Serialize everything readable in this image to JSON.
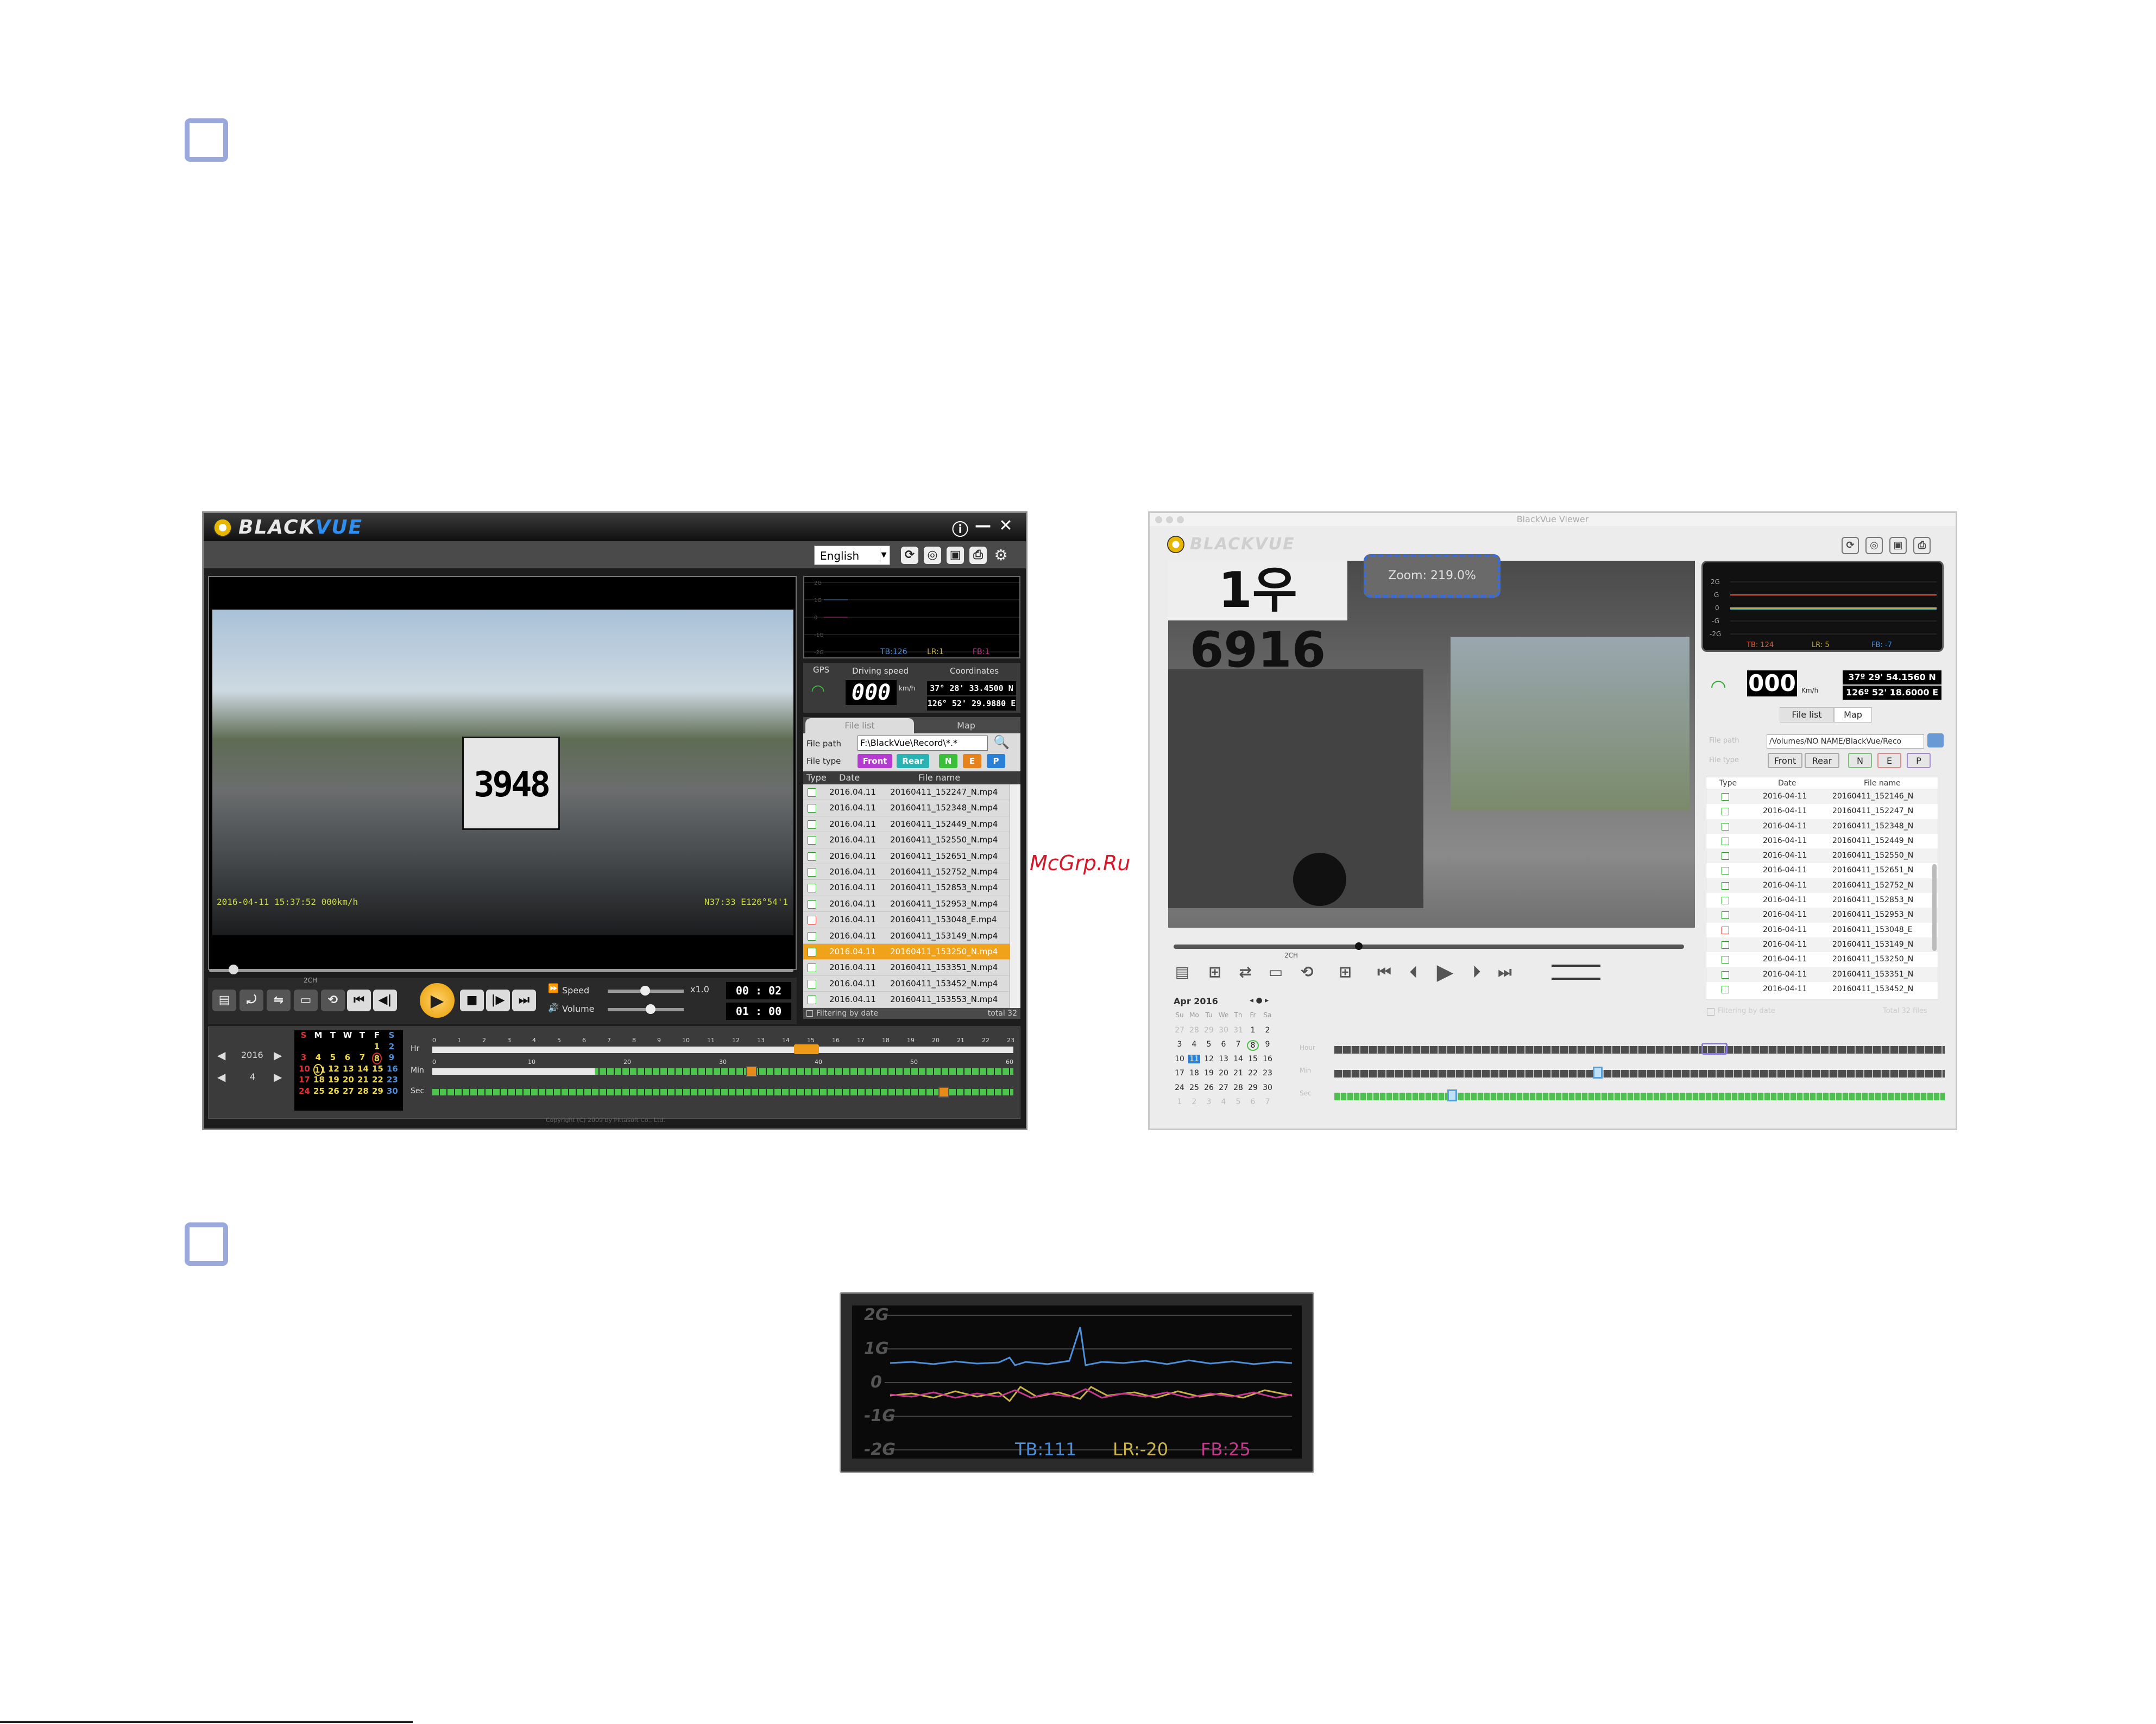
{
  "watermark": "McGrp.Ru",
  "windows_viewer": {
    "brand_prefix": "BLACK",
    "brand_suffix": "VUE",
    "title_buttons": [
      "ⓘ",
      "—",
      "✕"
    ],
    "language": "English",
    "toolbar_icons": [
      "refresh-icon",
      "map-upload-icon",
      "camera-icon",
      "print-icon",
      "gear-icon"
    ],
    "video": {
      "plate_text": "3948",
      "timestamp_left": "2016-04-11  15:37:52  000km/h",
      "timestamp_right": "N37:33  E126°54'1"
    },
    "playback": {
      "speed_label": "Speed",
      "speed_value": "x1.0",
      "volume_label": "Volume",
      "current_time": "00 : 02",
      "total_time": "01 : 00",
      "channel_label": "2CH"
    },
    "gsensor": {
      "y_labels": [
        "2G",
        "1G",
        "0",
        "-1G",
        "-2G"
      ],
      "legend": {
        "tb": "TB:126",
        "lr": "LR:1",
        "fb": "FB:1"
      }
    },
    "gps": {
      "gps_label": "GPS",
      "speed_label": "Driving speed",
      "speed_value": "000",
      "speed_unit": "km/h",
      "coords_label": "Coordinates",
      "lat": "37° 28' 33.4500 N",
      "lon": "126° 52' 29.9880 E"
    },
    "file_panel": {
      "tabs": [
        "File list",
        "Map"
      ],
      "file_path_label": "File path",
      "file_path_value": "F:\\BlackVue\\Record\\*.*",
      "file_type_label": "File type",
      "type_buttons": [
        "Front",
        "Rear",
        "N",
        "E",
        "P"
      ],
      "columns": [
        "Type",
        "Date",
        "File name"
      ],
      "rows": [
        {
          "date": "2016.04.11",
          "file": "20160411_152247_N.mp4",
          "event": false,
          "selected": false
        },
        {
          "date": "2016.04.11",
          "file": "20160411_152348_N.mp4",
          "event": false,
          "selected": false
        },
        {
          "date": "2016.04.11",
          "file": "20160411_152449_N.mp4",
          "event": false,
          "selected": false
        },
        {
          "date": "2016.04.11",
          "file": "20160411_152550_N.mp4",
          "event": false,
          "selected": false
        },
        {
          "date": "2016.04.11",
          "file": "20160411_152651_N.mp4",
          "event": false,
          "selected": false
        },
        {
          "date": "2016.04.11",
          "file": "20160411_152752_N.mp4",
          "event": false,
          "selected": false
        },
        {
          "date": "2016.04.11",
          "file": "20160411_152853_N.mp4",
          "event": false,
          "selected": false
        },
        {
          "date": "2016.04.11",
          "file": "20160411_152953_N.mp4",
          "event": false,
          "selected": false
        },
        {
          "date": "2016.04.11",
          "file": "20160411_153048_E.mp4",
          "event": true,
          "selected": false
        },
        {
          "date": "2016.04.11",
          "file": "20160411_153149_N.mp4",
          "event": false,
          "selected": false
        },
        {
          "date": "2016.04.11",
          "file": "20160411_153250_N.mp4",
          "event": false,
          "selected": true
        },
        {
          "date": "2016.04.11",
          "file": "20160411_153351_N.mp4",
          "event": false,
          "selected": false
        },
        {
          "date": "2016.04.11",
          "file": "20160411_153452_N.mp4",
          "event": false,
          "selected": false
        },
        {
          "date": "2016.04.11",
          "file": "20160411_153553_N.mp4",
          "event": false,
          "selected": false
        }
      ],
      "filter_label": "Filtering by date",
      "total": "total 32"
    },
    "timeline": {
      "year": "2016",
      "month": "4",
      "row_labels": [
        "Hr",
        "Min",
        "Sec"
      ],
      "weekdays": [
        "S",
        "M",
        "T",
        "W",
        "T",
        "F",
        "S"
      ],
      "weeks": [
        [
          "",
          "",
          "",
          "",
          "",
          "1",
          "2"
        ],
        [
          "3",
          "4",
          "5",
          "6",
          "7",
          "8",
          "9"
        ],
        [
          "10",
          "11",
          "12",
          "13",
          "14",
          "15",
          "16"
        ],
        [
          "17",
          "18",
          "19",
          "20",
          "21",
          "22",
          "23"
        ],
        [
          "24",
          "25",
          "26",
          "27",
          "28",
          "29",
          "30"
        ]
      ],
      "hour_ticks": [
        "0",
        "1",
        "2",
        "3",
        "4",
        "5",
        "6",
        "7",
        "8",
        "9",
        "10",
        "11",
        "12",
        "13",
        "14",
        "15",
        "16",
        "17",
        "18",
        "19",
        "20",
        "21",
        "22",
        "23"
      ],
      "minute_ticks": [
        "0",
        "10",
        "20",
        "30",
        "40",
        "50",
        "60"
      ]
    },
    "copyright": "Copyright (C) 2009 by Pittasoft Co., Ltd."
  },
  "mac_viewer": {
    "window_title": "BlackVue Viewer",
    "brand": "BLACKVUE",
    "toolbar_icons": [
      "refresh-icon",
      "map-upload-icon",
      "camera-icon",
      "print-icon"
    ],
    "video": {
      "plate_text": "1우6916",
      "zoom_label": "Zoom: 219.0%"
    },
    "controls": [
      "snapshot-icon",
      "record-icon",
      "channel-switch-icon",
      "pip-icon",
      "fullscreen-icon",
      "grid-icon",
      "skip-back-icon",
      "step-back-icon",
      "play-icon",
      "step-forward-icon",
      "skip-forward-icon"
    ],
    "channel_label": "2CH",
    "gsensor": {
      "y_labels": [
        "2G",
        "G",
        "0",
        "-G",
        "-2G"
      ],
      "legend": {
        "tb": "TB: 124",
        "lr": "LR: 5",
        "fb": "FB: -7"
      }
    },
    "gps": {
      "speed_value": "000",
      "speed_unit": "Km/h",
      "lat": "37º 29' 54.1560 N",
      "lon": "126º 52' 18.6000 E"
    },
    "file_panel": {
      "tabs": [
        "File list",
        "Map"
      ],
      "file_path_label": "File path",
      "file_path_value": "/Volumes/NO NAME/BlackVue/Reco",
      "file_type_label": "File type",
      "type_buttons": [
        "Front",
        "Rear",
        "N",
        "E",
        "P"
      ],
      "columns": [
        "Type",
        "Date",
        "File name"
      ],
      "rows": [
        {
          "date": "2016-04-11",
          "file": "20160411_152146_N",
          "event": false
        },
        {
          "date": "2016-04-11",
          "file": "20160411_152247_N",
          "event": false
        },
        {
          "date": "2016-04-11",
          "file": "20160411_152348_N",
          "event": false
        },
        {
          "date": "2016-04-11",
          "file": "20160411_152449_N",
          "event": false
        },
        {
          "date": "2016-04-11",
          "file": "20160411_152550_N",
          "event": false
        },
        {
          "date": "2016-04-11",
          "file": "20160411_152651_N",
          "event": false
        },
        {
          "date": "2016-04-11",
          "file": "20160411_152752_N",
          "event": false
        },
        {
          "date": "2016-04-11",
          "file": "20160411_152853_N",
          "event": false
        },
        {
          "date": "2016-04-11",
          "file": "20160411_152953_N",
          "event": false
        },
        {
          "date": "2016-04-11",
          "file": "20160411_153048_E",
          "event": true
        },
        {
          "date": "2016-04-11",
          "file": "20160411_153149_N",
          "event": false
        },
        {
          "date": "2016-04-11",
          "file": "20160411_153250_N",
          "event": false
        },
        {
          "date": "2016-04-11",
          "file": "20160411_153351_N",
          "event": false
        },
        {
          "date": "2016-04-11",
          "file": "20160411_153452_N",
          "event": false
        }
      ],
      "filter_label": "Filtering by date",
      "total": "Total 32 files"
    },
    "calendar": {
      "month": "Apr 2016",
      "weekdays": [
        "Su",
        "Mo",
        "Tu",
        "We",
        "Th",
        "Fr",
        "Sa"
      ],
      "weeks": [
        [
          "27",
          "28",
          "29",
          "30",
          "31",
          "1",
          "2"
        ],
        [
          "3",
          "4",
          "5",
          "6",
          "7",
          "8",
          "9"
        ],
        [
          "10",
          "11",
          "12",
          "13",
          "14",
          "15",
          "16"
        ],
        [
          "17",
          "18",
          "19",
          "20",
          "21",
          "22",
          "23"
        ],
        [
          "24",
          "25",
          "26",
          "27",
          "28",
          "29",
          "30"
        ],
        [
          "1",
          "2",
          "3",
          "4",
          "5",
          "6",
          "7"
        ]
      ],
      "selected_day": "11"
    },
    "timeline_labels": [
      "Hour",
      "Min",
      "Sec"
    ]
  },
  "gsensor_closeup": {
    "y_labels": [
      "2G",
      "1G",
      "0",
      "-1G",
      "-2G"
    ],
    "legend": {
      "tb": "TB:111",
      "lr": "LR:-20",
      "fb": "FB:25"
    },
    "colors": {
      "tb": "#4d8fd8",
      "lr": "#c9b24a",
      "fb": "#c23a8a"
    }
  }
}
